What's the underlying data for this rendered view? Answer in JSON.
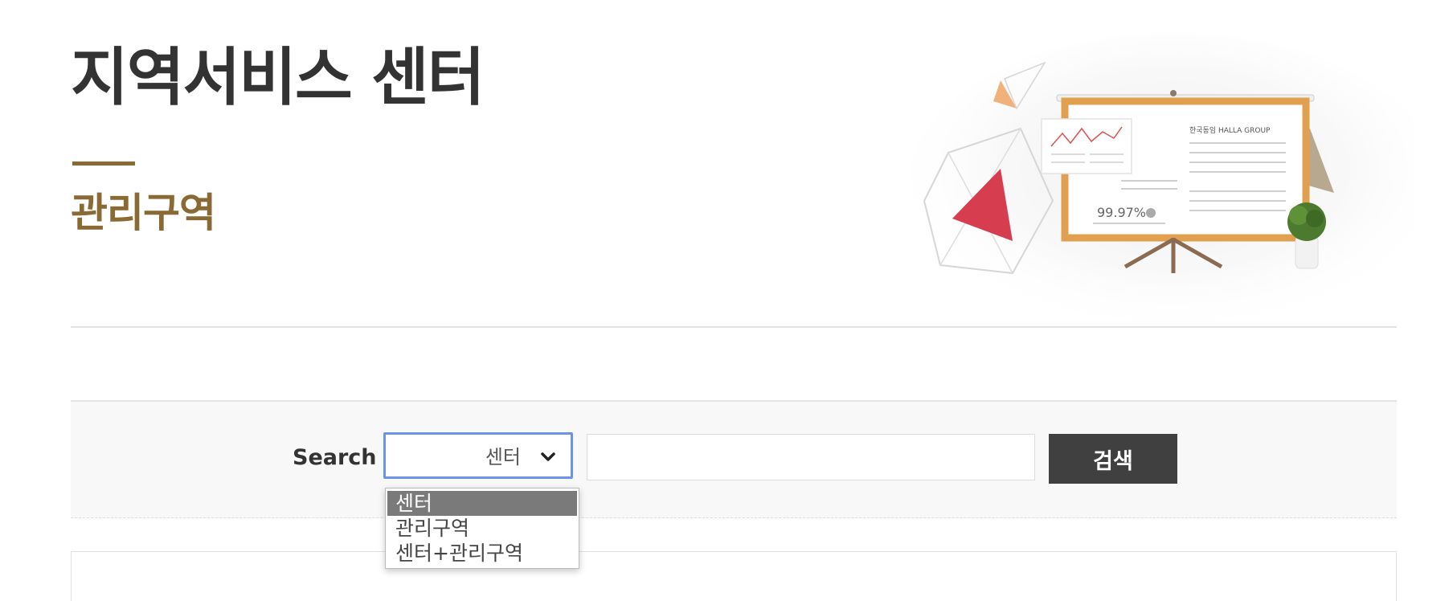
{
  "header": {
    "title": "지역서비스 센터",
    "subtitle": "관리구역"
  },
  "hero": {
    "presentation_text": "99.97%",
    "board_heading": "한국동임 HALLA GROUP"
  },
  "search": {
    "label": "Search",
    "select": {
      "selected": "센터",
      "options": [
        "센터",
        "관리구역",
        "센터+관리구역"
      ]
    },
    "input": {
      "value": "",
      "placeholder": ""
    },
    "button_label": "검색"
  },
  "colors": {
    "accent": "#8a6a34",
    "title": "#333333",
    "button_bg": "#404040",
    "select_focus": "#6b93e6",
    "option_selected_bg": "#7a7a7a"
  },
  "icons": {
    "select_arrow": "chevron-down-icon"
  }
}
